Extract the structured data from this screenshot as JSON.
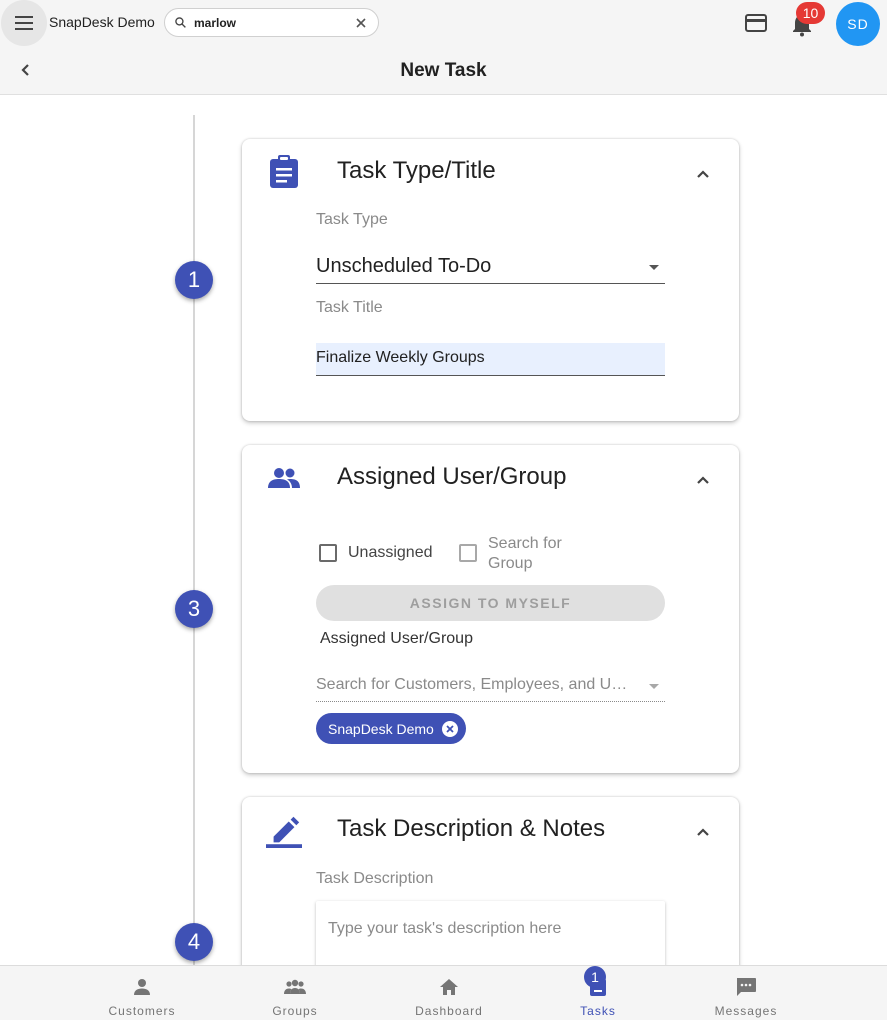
{
  "header": {
    "app_title": "SnapDesk Demo",
    "search_value": "marlow",
    "notification_count": "10",
    "avatar_initials": "SD",
    "page_title": "New Task"
  },
  "timeline": {
    "steps": [
      "1",
      "3",
      "4"
    ]
  },
  "task_type_card": {
    "title": "Task Type/Title",
    "task_type_label": "Task Type",
    "task_type_value": "Unscheduled To-Do",
    "task_title_label": "Task Title",
    "task_title_value": "Finalize Weekly Groups"
  },
  "assigned_card": {
    "title": "Assigned User/Group",
    "unassigned_label": "Unassigned",
    "unassigned_checked": false,
    "search_group_label_line1": "Search for",
    "search_group_label_line2": "Group",
    "search_group_checked": false,
    "assign_button": "ASSIGN TO MYSELF",
    "assigned_label": "Assigned User/Group",
    "search_placeholder": "Search for Customers, Employees, and Users",
    "chip_label": "SnapDesk Demo"
  },
  "description_card": {
    "title": "Task Description & Notes",
    "description_label": "Task Description",
    "description_placeholder": "Type your task's description here"
  },
  "bottom_nav": {
    "items": [
      {
        "label": "Customers",
        "icon": "person-icon"
      },
      {
        "label": "Groups",
        "icon": "groups-icon"
      },
      {
        "label": "Dashboard",
        "icon": "home-icon"
      },
      {
        "label": "Tasks",
        "icon": "tasks-icon",
        "active": true
      },
      {
        "label": "Messages",
        "icon": "message-icon"
      }
    ],
    "tasks_badge": "1"
  },
  "colors": {
    "primary": "#3f51b5",
    "avatar": "#2196f3",
    "badge": "#e53935"
  }
}
